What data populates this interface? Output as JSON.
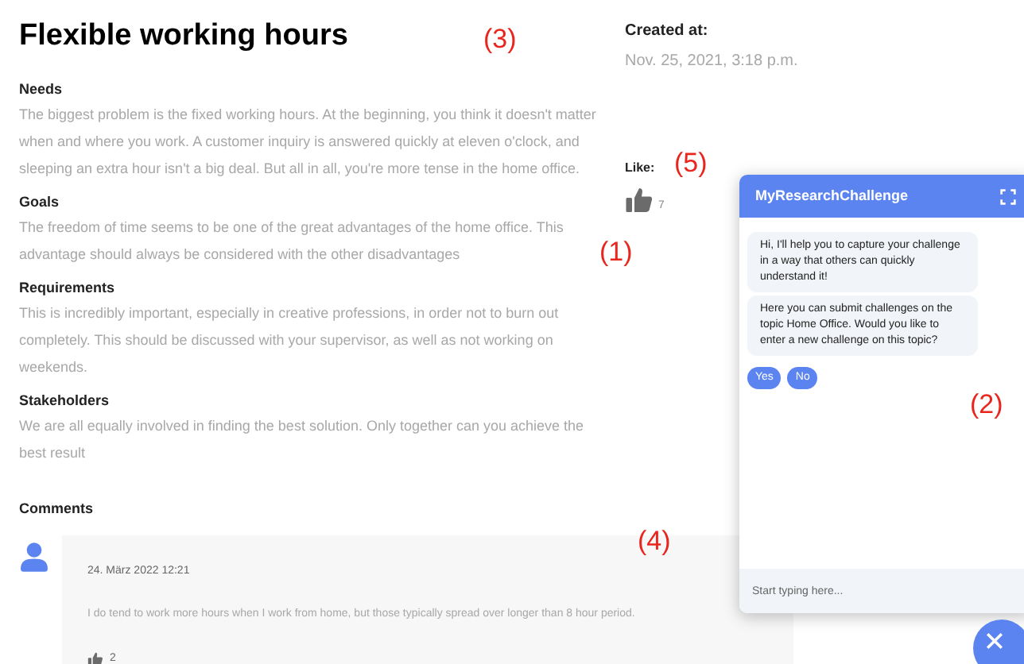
{
  "challenge": {
    "title": "Flexible working hours",
    "sections": [
      {
        "heading": "Needs",
        "text": "The biggest problem is the fixed working hours. At the beginning, you think it doesn't matter when and where you work. A customer inquiry is answered quickly at eleven o'clock, and sleeping an extra hour isn't a big deal. But all in all, you're more tense in the home office."
      },
      {
        "heading": "Goals",
        "text": "The freedom of time seems to be one of the great advantages of the home office. This advantage should always be considered with the other disadvantages"
      },
      {
        "heading": "Requirements",
        "text": "This is incredibly important, especially in creative professions, in order not to burn out completely. This should be discussed with your supervisor, as well as not working on weekends."
      },
      {
        "heading": "Stakeholders",
        "text": "We are all equally involved in finding the best solution. Only together can you achieve the best result"
      }
    ]
  },
  "meta": {
    "created_label": "Created at:",
    "created_value": "Nov. 25, 2021, 3:18 p.m.",
    "like_label": "Like:",
    "like_count": "7"
  },
  "comments": {
    "heading": "Comments",
    "items": [
      {
        "date": "24. März 2022 12:21",
        "text": "I do tend to work more hours when I work from home, but those typically spread over longer than 8 hour period.",
        "likes": "2"
      }
    ]
  },
  "chat": {
    "title": "MyResearchChallenge",
    "messages": [
      "Hi, I'll help you to capture your challenge in a way that others can quickly understand it!",
      "Here you can submit challenges on the topic Home Office. Would you like to enter a new challenge on this topic?"
    ],
    "replies": [
      "Yes",
      "No"
    ],
    "placeholder": "Start typing here..."
  },
  "annotations": [
    "(3)",
    "(1)",
    "(5)",
    "(2)",
    "(4)"
  ]
}
